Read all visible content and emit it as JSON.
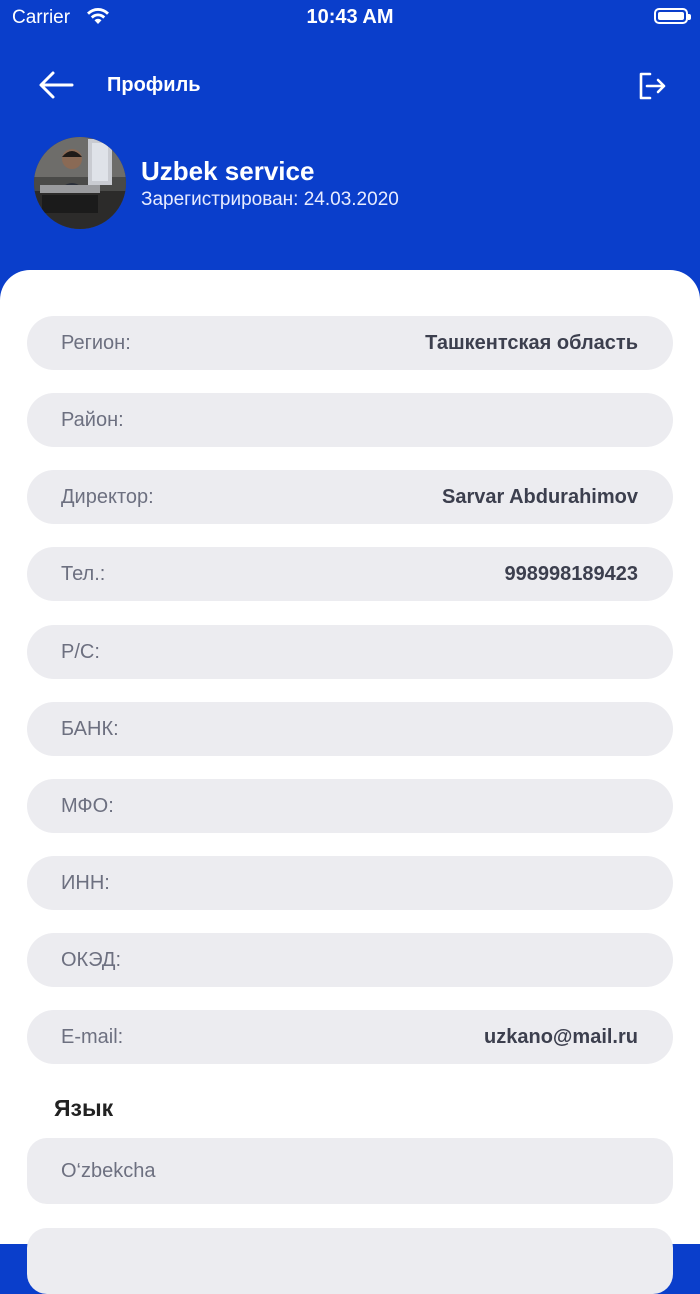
{
  "status_bar": {
    "carrier": "Carrier",
    "time": "10:43 AM"
  },
  "navbar": {
    "title": "Профиль",
    "back_icon": "arrow-left-icon",
    "logout_icon": "logout-icon"
  },
  "profile": {
    "name": "Uzbek service",
    "registered": "Зарегистрирован: 24.03.2020"
  },
  "fields": [
    {
      "label": "Регион:",
      "value": "Ташкентская область"
    },
    {
      "label": "Район:",
      "value": ""
    },
    {
      "label": "Директор:",
      "value": "Sarvar Abdurahimov"
    },
    {
      "label": "Тел.:",
      "value": "998998189423"
    },
    {
      "label": "Р/С:",
      "value": ""
    },
    {
      "label": "БАНК:",
      "value": ""
    },
    {
      "label": "МФО:",
      "value": ""
    },
    {
      "label": "ИНН:",
      "value": ""
    },
    {
      "label": "ОКЭД:",
      "value": ""
    },
    {
      "label": "E-mail:",
      "value": "uzkano@mail.ru"
    }
  ],
  "language": {
    "title": "Язык",
    "options": [
      {
        "label": "O‘zbekcha"
      },
      {
        "label": ""
      }
    ]
  },
  "colors": {
    "header_bg": "#0a3ecb",
    "row_bg": "#ececf0",
    "sheet_bg": "#ffffff"
  }
}
